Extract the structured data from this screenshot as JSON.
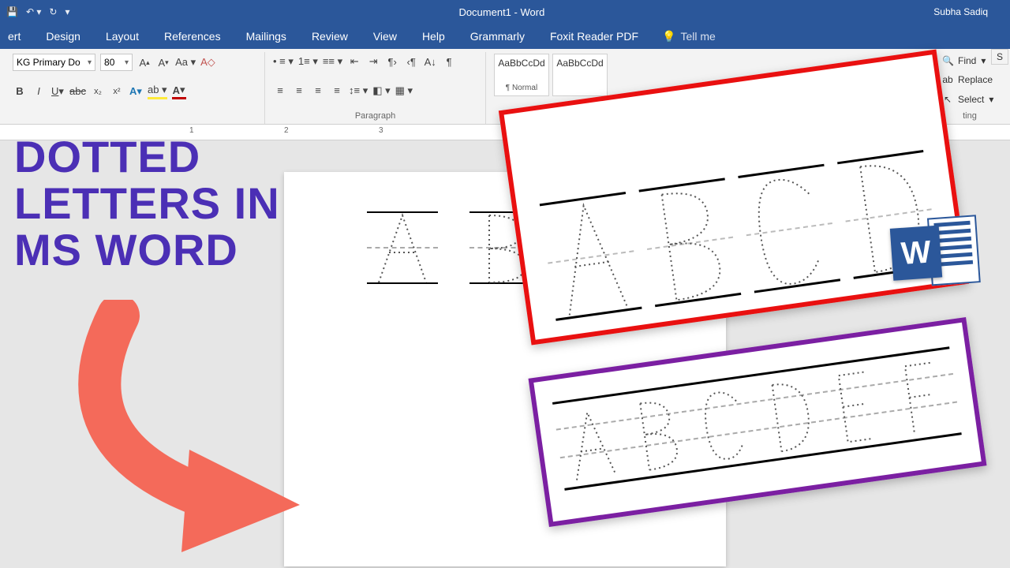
{
  "titlebar": {
    "doc_title": "Document1 - Word",
    "user_name": "Subha Sadiq"
  },
  "menubar": {
    "tabs": [
      "ert",
      "Design",
      "Layout",
      "References",
      "Mailings",
      "Review",
      "View",
      "Help",
      "Grammarly",
      "Foxit Reader PDF"
    ],
    "tell_me": "Tell me"
  },
  "ribbon": {
    "font_name": "KG Primary Do",
    "font_size": "80",
    "paragraph_label": "Paragraph",
    "styles": [
      {
        "sample": "AaBbCcDd",
        "name": "¶ Normal"
      },
      {
        "sample": "AaBbCcDd",
        "name": ""
      }
    ],
    "editing": {
      "find": "Find",
      "replace": "Replace",
      "select": "Select",
      "ting": "ting"
    }
  },
  "ruler": {
    "marks": [
      "1",
      "2",
      "3"
    ]
  },
  "headline": {
    "line1": "DOTTED",
    "line2": "LETTERS IN",
    "line3": "MS WORD"
  },
  "word_icon_letter": "W",
  "share_stub": "S"
}
